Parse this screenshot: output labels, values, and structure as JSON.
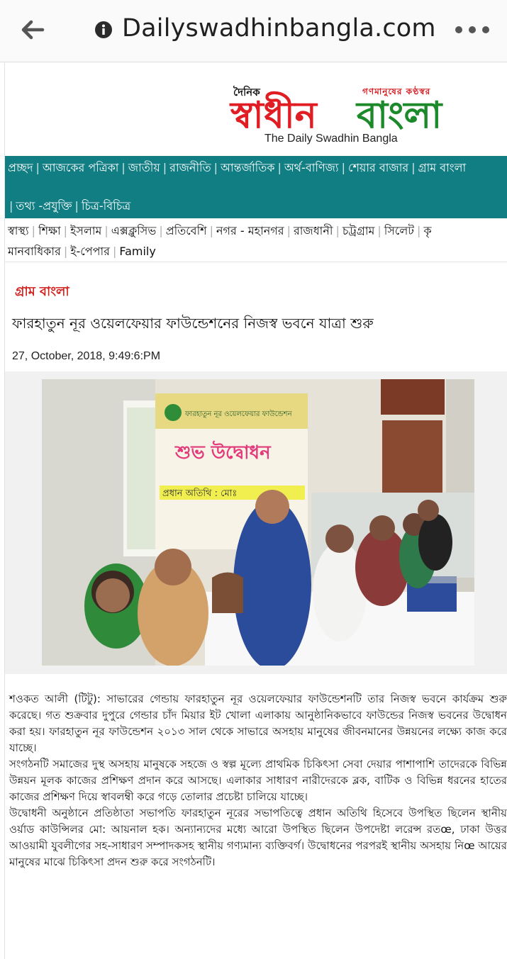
{
  "browser": {
    "url": "Dailyswadhinbangla.com",
    "back_icon": "arrow-left-icon",
    "info_icon": "info-icon",
    "menu_icon": "more-horizontal-icon"
  },
  "logo": {
    "dainik": "দৈনিক",
    "tagline": "গণমানুষের কণ্ঠস্বর",
    "swadhin": "স্বাধীন",
    "bangla": "বাংলা",
    "english": "The Daily Swadhin Bangla"
  },
  "main_nav": {
    "row1": [
      "প্রচ্ছদ",
      "আজকের পত্রিকা",
      "জাতীয়",
      "রাজনীতি",
      "আন্তর্জাতিক",
      "অর্থ-বাণিজ্য",
      "শেয়ার বাজার",
      "গ্রাম বাংলা"
    ],
    "row2": [
      "তথ্য -প্রযুক্তি",
      "চিত্র-বিচিত্র"
    ]
  },
  "sub_nav": {
    "row1": [
      "স্বাস্থ্য",
      "শিক্ষা",
      "ইসলাম",
      "এক্সক্লুসিভ",
      "প্রতিবেশি",
      "নগর - মহানগর",
      "রাজধানী",
      "চট্রগ্রাম",
      "সিলেট",
      "কৃ"
    ],
    "row2": [
      "মানবাধিকার",
      "ই-পেপার",
      "Family"
    ]
  },
  "article": {
    "category": "গ্রাম বাংলা",
    "headline": "ফারহাতুন নূর ওয়েলফেয়ার ফাউন্ডেশনের নিজস্ব ভবনে যাত্রা শুরু",
    "date": "27, October, 2018, 9:49:6:PM",
    "banner_title": "শুভ উদ্বোধন",
    "banner_line": "প্রধান অতিথি : মোঃ",
    "banner_header": "ফারহাতুন নূর ওয়েলফেয়ার ফাউন্ডেশন",
    "paragraphs": [
      "শওকত আলী (টিটু): সাভারের গেন্ডায় ফারহাতুন নূর ওয়েলফেয়ার ফাউন্ডেশনটি তার নিজস্ব ভবনে কার্যক্রম শুরু করেছে। গত শুক্রবার দুপুরে গেন্ডার চাঁদ মিয়ার ইট খোলা এলাকায় আনুষ্ঠানিকভাবে ফাউন্ডের নিজস্ব ভবনের উদ্বোধন করা হয়। ফারহাতুন নূর ফাউন্ডেশন ২০১৩ সাল থেকে সাভারে অসহায় মানুষের জীবনমানের উন্নয়নের লক্ষ্যে কাজ করে যাচ্ছে।",
      "সংগঠনটি সমাজের দুস্থ অসহায় মানুষকে সহজে ও স্বল্প মূল্যে প্রাথমিক চিকিৎসা সেবা দেয়ার পাশাপাশি তাদেরকে বিভিন্ন উন্নয়ন মূলক কাজের প্রশিক্ষণ প্রদান করে আসছে। এলাকার সাধারণ নারীদেরকে ব্লক, বাটিক ও বিভিন্ন ধরনের হাতের কাজের প্রশিক্ষণ দিয়ে স্বাবলম্বী করে গড়ে তোলার প্রচেষ্টা চালিয়ে যাচ্ছে।",
      "উদ্বোধনী অনুষ্ঠানে প্রতিষ্ঠাতা সভাপতি ফারহাতুন নূরের সভাপতিত্বে প্রধান অতিথি হিসেবে উপস্থিত ছিলেন স্থানীয় ওর্য়াড কাউন্সিলর মো: আয়নাল হক। অন্যান্যদের মধ্যে আরো উপস্থিত ছিলেন উপদেষ্টা লরেন্স রতœ, ঢাকা উত্তর আওয়ামী যুবলীগের সহ-সাধারণ সম্পাদকসহ স্থানীয় গণ্যমান্য ব্যক্তিবর্গ। উদ্বোধনের পরপরই স্থানীয় অসহায় নিœ আয়ের মানুষের মাঝে চিকিৎসা প্রদন শুরু করে সংগঠনটি।"
    ]
  }
}
